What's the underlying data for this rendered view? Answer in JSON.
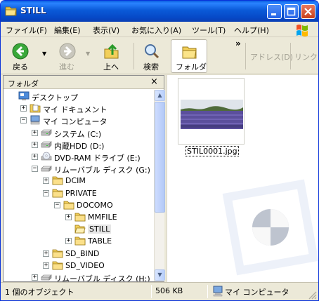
{
  "window": {
    "title": "STILL"
  },
  "menu": {
    "items": [
      "ファイル(F)",
      "編集(E)",
      "表示(V)",
      "お気に入り(A)",
      "ツール(T)",
      "ヘルプ(H)"
    ]
  },
  "toolbar": {
    "back": "戻る",
    "forward": "進む",
    "up": "上へ",
    "search": "検索",
    "folders": "フォルダ",
    "overflow": "»",
    "address": "アドレス(D)",
    "links": "リンク"
  },
  "folder_pane": {
    "title": "フォルダ",
    "close": "×",
    "tree": [
      {
        "label": "デスクトップ",
        "icon": "desktop-icon"
      },
      {
        "label": "マイ ドキュメント",
        "icon": "my-documents-icon",
        "expander": "+"
      },
      {
        "label": "マイ コンピュータ",
        "icon": "my-computer-icon",
        "expander": "−"
      },
      {
        "label": "システム (C:)",
        "icon": "hard-drive-icon",
        "expander": "+"
      },
      {
        "label": "内蔵HDD (D:)",
        "icon": "hard-drive-icon",
        "expander": "+"
      },
      {
        "label": "DVD-RAM ドライブ (E:)",
        "icon": "dvd-drive-icon",
        "expander": "+"
      },
      {
        "label": "リムーバブル ディスク (G:)",
        "icon": "removable-disk-icon",
        "expander": "−"
      },
      {
        "label": "DCIM",
        "icon": "folder-icon",
        "expander": "+"
      },
      {
        "label": "PRIVATE",
        "icon": "folder-icon",
        "expander": "−"
      },
      {
        "label": "DOCOMO",
        "icon": "folder-icon",
        "expander": "−"
      },
      {
        "label": "MMFILE",
        "icon": "folder-icon",
        "expander": "+"
      },
      {
        "label": "STILL",
        "icon": "folder-open-icon",
        "selected": true
      },
      {
        "label": "TABLE",
        "icon": "folder-icon",
        "expander": "+"
      },
      {
        "label": "SD_BIND",
        "icon": "folder-icon",
        "expander": "+"
      },
      {
        "label": "SD_VIDEO",
        "icon": "folder-icon",
        "expander": "+"
      },
      {
        "label": "リムーバブル ディスク (H:)",
        "icon": "removable-disk-icon",
        "expander": "+"
      }
    ]
  },
  "content": {
    "files": [
      {
        "name": "STIL0001.jpg"
      }
    ]
  },
  "status": {
    "objects": "1 個のオブジェクト",
    "size": "506 KB",
    "location": "マイ コンピュータ"
  }
}
